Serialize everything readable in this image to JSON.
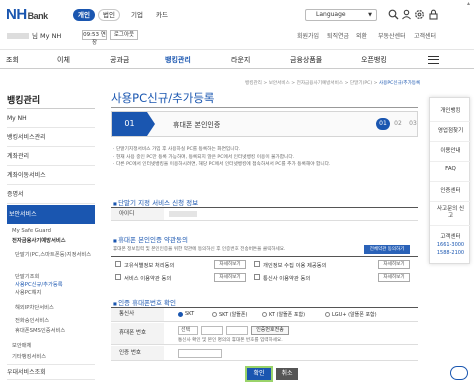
{
  "header": {
    "logo": "NH",
    "logo_sub": "Bank",
    "segments": [
      "개인",
      "법인",
      "기업",
      "카드"
    ],
    "language": "Language",
    "icons": [
      "search-icon",
      "user-icon",
      "settings-icon",
      "lock-icon"
    ]
  },
  "userbar": {
    "username": "님 My NH",
    "timer": "09:53 연장",
    "logout": "로그아웃",
    "links": [
      "회원가입",
      "퇴직연금",
      "외환",
      "퇴직연금",
      "부동산센터",
      "고객센터"
    ]
  },
  "gnb": [
    "조회",
    "이체",
    "공과금",
    "뱅킹관리",
    "라운지",
    "금융상품몰",
    "오픈뱅킹"
  ],
  "sidebar": {
    "title": "뱅킹관리",
    "items": [
      "My NH",
      "뱅킹서비스관리",
      "계좌관리",
      "계좌이동서비스",
      "증명서",
      "보안서비스"
    ],
    "sub": [
      "My Safe Guard",
      "전자금융사기예방서비스",
      "단말기(PC,스마트폰등)지정서비스",
      "단말기조회",
      "사용PC신규/추가등록",
      "사용PC해지",
      "해외IP차단서비스",
      "전화승인서비스",
      "휴대폰SMS인증서비스"
    ],
    "items2": [
      "보안매체",
      "기타뱅킹서비스",
      "이체관리",
      "우대서비스조회"
    ]
  },
  "breadcrumb": [
    "뱅킹관리",
    "보안서비스",
    "전자금융사기예방서비스",
    "단말기(PC)",
    "사용PC신규/추가등록"
  ],
  "page": {
    "title": "사용PC신규/추가등록",
    "step_num": "01",
    "step_label": "휴대폰 본인인증",
    "steps": [
      "01",
      "02",
      "03"
    ],
    "notes": [
      "· 단말기지정서비스 가입 후 사용하실 PC를 등록하는 화면입니다.",
      "· 현재 사용 중인 PC만 등록 가능하며, 등록되지 않은 PC에서 인터넷뱅킹 이용이 불가합니다.",
      "· 다른 PC에서 인터넷뱅킹을 이용하시려면, 해당 PC에서 인터넷뱅킹에 접속하셔서 PC를 추가 등록해야 합니다."
    ],
    "sec1": "단말기 지정 서비스 신청 정보",
    "id_label": "아이디",
    "sec2": "휴대폰 본인인증 약관동의",
    "consent_note": "휴대폰 정보입력 및 본인인증을 위한 약관에 동의하신 후 인증번호 전송버튼을 클릭하세요.",
    "consent_all": "전체약관 동의하기",
    "consents": [
      "고유식별정보 처리동의",
      "개인정보 수집 이용 제공동의",
      "서비스 이용약관 동의",
      "통신사 이용약관 동의"
    ],
    "view_label": "자세히보기",
    "sec3": "인증 휴대폰번호 확인",
    "carrier_label": "통신사",
    "carriers": [
      "SKT",
      "SKT (알뜰폰)",
      "KT (알뜰폰 포함)",
      "LGU+ (알뜰폰 포함)"
    ],
    "phone_label": "휴대폰 번호",
    "phone_select": "선택",
    "send_btn": "인증번호전송",
    "phone_note": "통신사 확인 및 본인 명의의 휴대폰 번호를 입력하세요.",
    "code_label": "인증 번호",
    "confirm": "확인",
    "cancel": "취소"
  },
  "quickmenu": {
    "items": [
      "개인뱅킹",
      "영업점찾기",
      "이용안내",
      "FAQ",
      "인증센터",
      "사고문의 신고",
      "고객센터"
    ],
    "phones": [
      "1661-3000",
      "1588-2100"
    ]
  },
  "colors": {
    "brand": "#1a56b0",
    "highlight": "#9ad36a"
  }
}
